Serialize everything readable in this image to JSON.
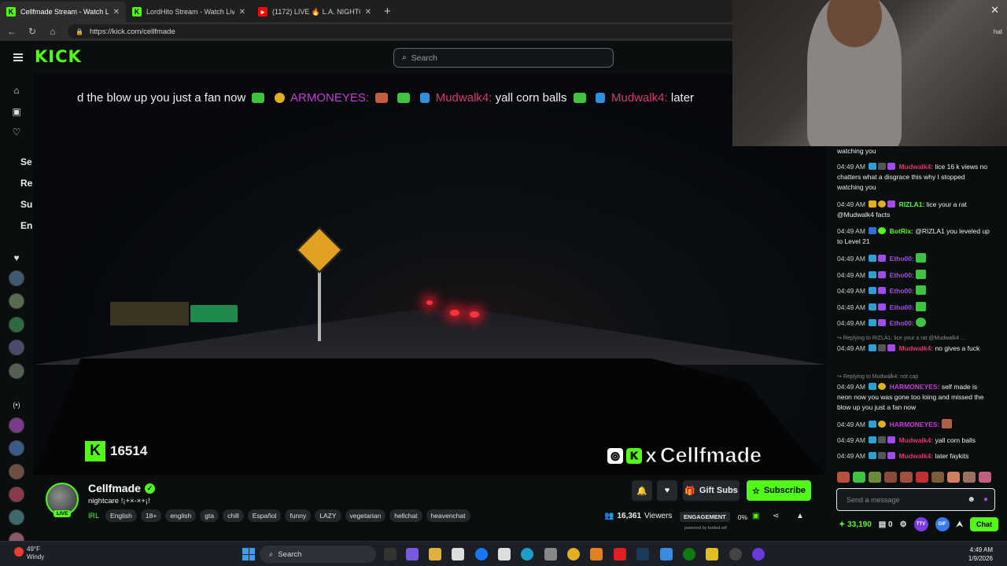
{
  "browser": {
    "tabs": [
      {
        "title": "Cellfmade Stream - Watch Liv",
        "icon": "kick-icon",
        "active": true
      },
      {
        "title": "LordHito Stream - Watch Live",
        "icon": "kick-icon",
        "active": false
      },
      {
        "title": "(1172) LIVE 🔥 L.A. NIGHTCR",
        "icon": "youtube-icon",
        "active": false
      }
    ],
    "url": "https://kick.com/cellfmade"
  },
  "header": {
    "logo": "KICK",
    "search_placeholder": "Search"
  },
  "sidebar": {
    "letters": [
      "Se",
      "Re",
      "Su",
      "En"
    ]
  },
  "video": {
    "marquee": {
      "part1": "d the blow up you just a fan now",
      "user1": "ARMONEYES:",
      "user2": "Mudwalk4:",
      "text2": "yall corn balls",
      "user3": "Mudwalk4:",
      "text3": "later"
    },
    "viewer_count": "16514",
    "watermark": "Cellfmade"
  },
  "webcam": {
    "chat_label": "hat"
  },
  "streamer": {
    "name": "Cellfmade",
    "live": "LIVE",
    "title": "nightcare !¡+×-×+¡!",
    "category": "IRL",
    "tags": [
      "English",
      "18+",
      "english",
      "gta",
      "chill",
      "Español",
      "funny",
      "LAZY",
      "vegetarian",
      "hellchat",
      "heavenchat"
    ],
    "gift_subs": "Gift Subs",
    "subscribe": "Subscribe",
    "viewers": "16,361",
    "viewers_label": "Viewers",
    "engagement_label": "ENGAGEMENT",
    "engagement_value": "0%",
    "powered": "powered by botted.wtf"
  },
  "chat": {
    "messages": [
      {
        "time": "",
        "user": "",
        "text": "watching you"
      },
      {
        "time": "04:49 AM",
        "user": "Mudwalk4:",
        "user_color": "#d53b6a",
        "text": "lice 16 k views no chatters what a disgrace this why I stopped watching you"
      },
      {
        "time": "04:49 AM",
        "user": "RIZLA1:",
        "user_color": "#53fc18",
        "text": "lice your a rat @Mudwalk4 facts"
      },
      {
        "time": "04:49 AM",
        "user": "BotRix:",
        "user_color": "#53fc18",
        "text": "@RIZLA1 you leveled up to Level 21"
      },
      {
        "time": "04:49 AM",
        "user": "Etho00:",
        "user_color": "#a24ce8",
        "text": ""
      },
      {
        "time": "04:49 AM",
        "user": "Etho00:",
        "user_color": "#a24ce8",
        "text": ""
      },
      {
        "time": "04:49 AM",
        "user": "Etho00:",
        "user_color": "#a24ce8",
        "text": ""
      },
      {
        "time": "04:49 AM",
        "user": "Etho00:",
        "user_color": "#a24ce8",
        "text": ""
      },
      {
        "time": "04:49 AM",
        "user": "Etho00:",
        "user_color": "#a24ce8",
        "text": ""
      },
      {
        "time": "04:49 AM",
        "user": "Mudwalk4:",
        "user_color": "#d53b6a",
        "text": "no   gives a fuck",
        "reply": "Replying to RIZLA1: lice your a rat @Mudwalk4 ..."
      },
      {
        "time": "04:49 AM",
        "user": "HARMONEYES:",
        "user_color": "#c53bd8",
        "text": "self made is neon now you was gone too loing and missed the blow up you just a fan now",
        "reply": "Replying to Mudwalk4: not cap"
      },
      {
        "time": "04:49 AM",
        "user": "HARMONEYES:",
        "user_color": "#c53bd8",
        "text": ""
      },
      {
        "time": "04:49 AM",
        "user": "Mudwalk4:",
        "user_color": "#d53b6a",
        "text": "yall corn balls"
      },
      {
        "time": "04:49 AM",
        "user": "Mudwalk4:",
        "user_color": "#d53b6a",
        "text": "later faykits"
      }
    ],
    "input_placeholder": "Send a message",
    "points": "33,190",
    "zero": "0",
    "ttv": "TTV",
    "gif": "GIF",
    "chat_button": "Chat"
  },
  "taskbar": {
    "temp": "49°F",
    "weather": "Windy",
    "search": "Search",
    "time": "4:49 AM",
    "date": "1/9/2026"
  }
}
